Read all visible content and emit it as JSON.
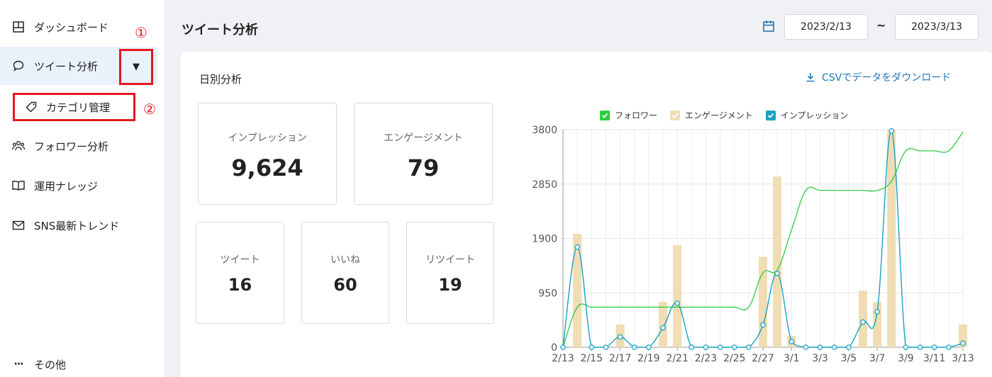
{
  "sidebar": {
    "items": [
      {
        "label": "ダッシュボード",
        "icon": "dashboard-icon"
      },
      {
        "label": "ツイート分析",
        "icon": "speech-bubble-icon"
      },
      {
        "label": "フォロワー分析",
        "icon": "people-icon"
      },
      {
        "label": "運用ナレッジ",
        "icon": "book-icon"
      },
      {
        "label": "SNS最新トレンド",
        "icon": "mail-icon"
      }
    ],
    "sub_item": {
      "label": "カテゴリ管理",
      "icon": "tag-icon"
    },
    "more_label": "その他",
    "annotation_1": "①",
    "annotation_2": "②",
    "toggle_glyph": "▼"
  },
  "header": {
    "title": "ツイート分析",
    "date_from": "2023/2/13",
    "date_to": "2023/3/13",
    "tilde": "~"
  },
  "main": {
    "section_title": "日別分析",
    "csv_label": "CSVでデータをダウンロード",
    "stats": {
      "impressions": {
        "label": "インプレッション",
        "value": "9,624"
      },
      "engagement": {
        "label": "エンゲージメント",
        "value": "79"
      },
      "tweets": {
        "label": "ツイート",
        "value": "16"
      },
      "likes": {
        "label": "いいね",
        "value": "60"
      },
      "retweets": {
        "label": "リツイート",
        "value": "19"
      }
    }
  },
  "colors": {
    "accent": "#2178b8",
    "highlight": "#e5171e",
    "follower": "#2ecc40",
    "engagement": "#f0ddb4",
    "impression": "#17a2c2"
  },
  "chart_data": {
    "type": "bar",
    "legend": [
      "フォロワー",
      "エンゲージメント",
      "インプレッション"
    ],
    "x": [
      "2/13",
      "2/14",
      "2/15",
      "2/16",
      "2/17",
      "2/18",
      "2/19",
      "2/20",
      "2/21",
      "2/22",
      "2/23",
      "2/24",
      "2/25",
      "2/26",
      "2/27",
      "2/28",
      "3/1",
      "3/2",
      "3/3",
      "3/4",
      "3/5",
      "3/6",
      "3/7",
      "3/8",
      "3/9",
      "3/10",
      "3/11",
      "3/12",
      "3/13"
    ],
    "x_tick_labels": [
      "2/13",
      "2/15",
      "2/17",
      "2/19",
      "2/21",
      "2/23",
      "2/25",
      "2/27",
      "3/1",
      "3/3",
      "3/5",
      "3/7",
      "3/9",
      "3/11",
      "3/13"
    ],
    "y_ticks": [
      "0",
      "950",
      "1900",
      "2850",
      "3800"
    ],
    "ylim": [
      0,
      3800
    ],
    "series": [
      {
        "name": "フォロワー",
        "kind": "line",
        "values": [
          0,
          700,
          700,
          700,
          700,
          700,
          700,
          700,
          700,
          700,
          700,
          700,
          700,
          700,
          1300,
          1350,
          2050,
          2740,
          2740,
          2740,
          2740,
          2740,
          2740,
          2900,
          3430,
          3430,
          3430,
          3430,
          3760
        ]
      },
      {
        "name": "エンゲージメント",
        "kind": "bar",
        "values": [
          0,
          1980,
          0,
          0,
          400,
          0,
          0,
          790,
          1780,
          0,
          0,
          0,
          0,
          0,
          1580,
          2980,
          200,
          0,
          0,
          0,
          0,
          990,
          790,
          3790,
          0,
          0,
          0,
          0,
          400
        ]
      },
      {
        "name": "インプレッション",
        "kind": "line",
        "values": [
          0,
          1750,
          0,
          0,
          180,
          0,
          0,
          340,
          770,
          0,
          0,
          0,
          0,
          0,
          390,
          1290,
          100,
          0,
          0,
          0,
          0,
          440,
          620,
          3780,
          0,
          0,
          0,
          0,
          70
        ]
      }
    ]
  }
}
